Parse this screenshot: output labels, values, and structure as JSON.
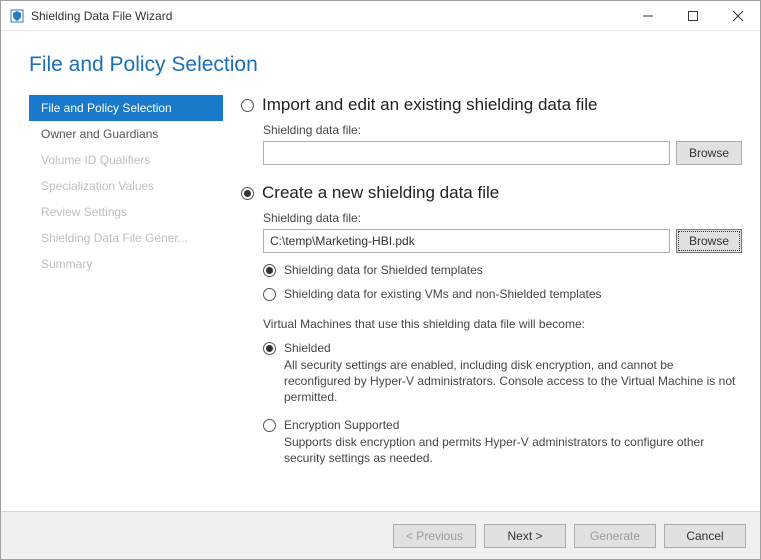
{
  "window": {
    "title": "Shielding Data File Wizard"
  },
  "page_title": "File and Policy Selection",
  "sidebar": {
    "items": [
      {
        "label": "File and Policy Selection",
        "active": true,
        "enabled": true
      },
      {
        "label": "Owner and Guardians",
        "active": false,
        "enabled": true
      },
      {
        "label": "Volume ID Qualifiers",
        "active": false,
        "enabled": false
      },
      {
        "label": "Specialization Values",
        "active": false,
        "enabled": false
      },
      {
        "label": "Review Settings",
        "active": false,
        "enabled": false
      },
      {
        "label": "Shielding Data File Gener...",
        "active": false,
        "enabled": false
      },
      {
        "label": "Summary",
        "active": false,
        "enabled": false
      }
    ]
  },
  "options": {
    "import": {
      "heading": "Import and edit an existing shielding data file",
      "field_label": "Shielding data file:",
      "value": "",
      "browse_label": "Browse"
    },
    "create": {
      "heading": "Create a new shielding data file",
      "field_label": "Shielding data file:",
      "value": "C:\\temp\\Marketing-HBI.pdk",
      "browse_label": "Browse",
      "template_opts": {
        "shielded": "Shielding data for Shielded templates",
        "existing": "Shielding data for existing VMs and non-Shielded templates"
      },
      "intro": "Virtual Machines that use this shielding data file will become:",
      "mode": {
        "shielded_label": "Shielded",
        "shielded_desc": "All security settings are enabled, including disk encryption, and cannot be reconfigured by Hyper-V administrators. Console access to the Virtual Machine is not permitted.",
        "encsup_label": "Encryption Supported",
        "encsup_desc": "Supports disk encryption and permits Hyper-V administrators to configure other security settings as needed."
      }
    }
  },
  "footer": {
    "previous": "< Previous",
    "next": "Next >",
    "generate": "Generate",
    "cancel": "Cancel"
  }
}
